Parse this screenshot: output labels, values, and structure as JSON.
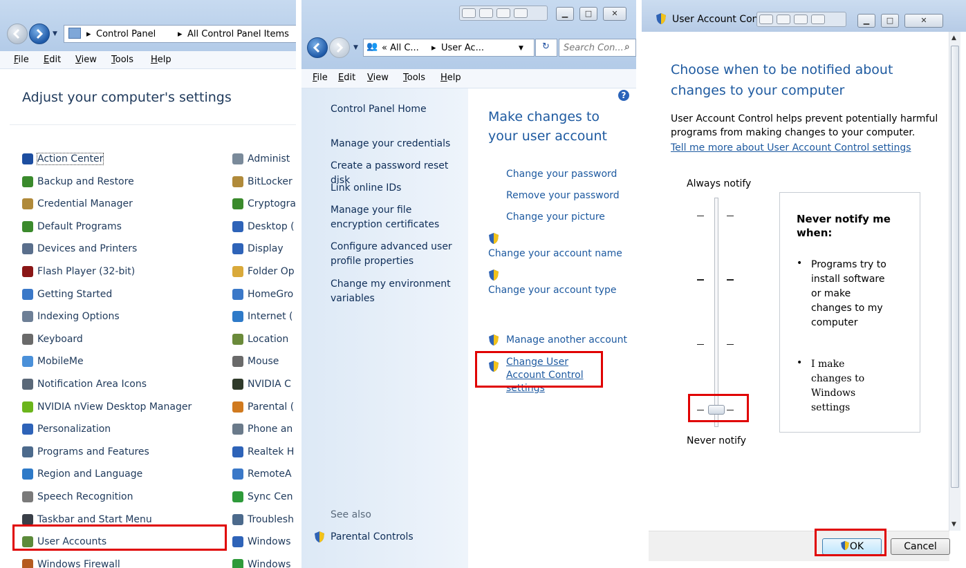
{
  "panel1": {
    "breadcrumb": [
      "Control Panel",
      "All Control Panel Items"
    ],
    "menu": [
      "File",
      "Edit",
      "View",
      "Tools",
      "Help"
    ],
    "heading": "Adjust your computer's settings",
    "left_items": [
      {
        "label": "Action Center",
        "icon": "flag-icon",
        "color": "#1d4ea0"
      },
      {
        "label": "Backup and Restore",
        "icon": "backup-icon",
        "color": "#3a8a2c"
      },
      {
        "label": "Credential Manager",
        "icon": "vault-icon",
        "color": "#b08a3a"
      },
      {
        "label": "Default Programs",
        "icon": "default-programs-icon",
        "color": "#3b8a2c"
      },
      {
        "label": "Devices and Printers",
        "icon": "printer-icon",
        "color": "#5a6f8c"
      },
      {
        "label": "Flash Player (32-bit)",
        "icon": "flash-icon",
        "color": "#8a1616"
      },
      {
        "label": "Getting Started",
        "icon": "getting-started-icon",
        "color": "#3a78c8"
      },
      {
        "label": "Indexing Options",
        "icon": "indexing-icon",
        "color": "#6d7f96"
      },
      {
        "label": "Keyboard",
        "icon": "keyboard-icon",
        "color": "#6a6a6a"
      },
      {
        "label": "MobileMe",
        "icon": "cloud-icon",
        "color": "#4a90d9"
      },
      {
        "label": "Notification Area Icons",
        "icon": "notification-icon",
        "color": "#5a6878"
      },
      {
        "label": "NVIDIA nView Desktop Manager",
        "icon": "nvidia-icon",
        "color": "#6bb51c"
      },
      {
        "label": "Personalization",
        "icon": "personalization-icon",
        "color": "#2e63b8"
      },
      {
        "label": "Programs and Features",
        "icon": "programs-icon",
        "color": "#4c6a8c"
      },
      {
        "label": "Region and Language",
        "icon": "globe-icon",
        "color": "#2e7ac8"
      },
      {
        "label": "Speech Recognition",
        "icon": "microphone-icon",
        "color": "#7a7a7a"
      },
      {
        "label": "Taskbar and Start Menu",
        "icon": "taskbar-icon",
        "color": "#3a3f48"
      },
      {
        "label": "User Accounts",
        "icon": "users-icon",
        "color": "#5c8a3a"
      },
      {
        "label": "Windows Firewall",
        "icon": "firewall-icon",
        "color": "#b55a1f"
      }
    ],
    "right_items": [
      {
        "label": "Administ",
        "icon": "admin-tools-icon",
        "color": "#7a8a9a"
      },
      {
        "label": "BitLocker",
        "icon": "bitlocker-icon",
        "color": "#b08a3a"
      },
      {
        "label": "Cryptogra",
        "icon": "crypto-icon",
        "color": "#3a8a2c"
      },
      {
        "label": "Desktop (",
        "icon": "desktop-gadgets-icon",
        "color": "#2e63b8"
      },
      {
        "label": "Display",
        "icon": "display-icon",
        "color": "#2e63b8"
      },
      {
        "label": "Folder Op",
        "icon": "folder-icon",
        "color": "#d9a93a"
      },
      {
        "label": "HomeGro",
        "icon": "homegroup-icon",
        "color": "#3a78c8"
      },
      {
        "label": "Internet (",
        "icon": "internet-icon",
        "color": "#2e7ac8"
      },
      {
        "label": "Location",
        "icon": "location-icon",
        "color": "#6a8a3a"
      },
      {
        "label": "Mouse",
        "icon": "mouse-icon",
        "color": "#6a6a6a"
      },
      {
        "label": "NVIDIA C",
        "icon": "nvidia-icon",
        "color": "#2f3a2a"
      },
      {
        "label": "Parental (",
        "icon": "parental-icon",
        "color": "#d07a1f"
      },
      {
        "label": "Phone an",
        "icon": "phone-icon",
        "color": "#6a7a8a"
      },
      {
        "label": "Realtek H",
        "icon": "realtek-icon",
        "color": "#2e63b8"
      },
      {
        "label": "RemoteA",
        "icon": "remoteapp-icon",
        "color": "#3a78c8"
      },
      {
        "label": "Sync Cen",
        "icon": "sync-icon",
        "color": "#2e9a3a"
      },
      {
        "label": "Troublesh",
        "icon": "troubleshoot-icon",
        "color": "#4c6a8c"
      },
      {
        "label": "Windows",
        "icon": "windows-cardspace-icon",
        "color": "#2e63b8"
      },
      {
        "label": "Windows",
        "icon": "windows-defender-icon",
        "color": "#2e9a3a"
      }
    ]
  },
  "panel2": {
    "address": [
      "« All C...",
      "User Ac..."
    ],
    "search_placeholder": "Search Con...",
    "menu": [
      "File",
      "Edit",
      "View",
      "Tools",
      "Help"
    ],
    "tasks": [
      "Control Panel Home",
      "Manage your credentials",
      "Create a password reset disk",
      "Link online IDs",
      "Manage your file encryption certificates",
      "Configure advanced user profile properties",
      "Change my environment variables"
    ],
    "see_also": "See also",
    "parental": "Parental Controls",
    "heading": "Make changes to your user account",
    "links": {
      "change_password": "Change your password",
      "remove_password": "Remove your password",
      "change_picture": "Change your picture",
      "change_name": "Change your account name",
      "change_type": "Change your account type",
      "manage_other": "Manage another account",
      "uac": "Change User Account Control settings"
    }
  },
  "panel3": {
    "title": "User Account Contr",
    "heading": "Choose when to be notified about changes to your computer",
    "description": "User Account Control helps prevent potentially harmful programs from making changes to your computer.",
    "more_link": "Tell me more about User Account Control settings",
    "always_label": "Always notify",
    "never_label": "Never notify",
    "slider_level": 0,
    "slider_levels": 4,
    "box_heading": "Never notify me when:",
    "bullets": [
      "Programs try to install software or make changes to my computer",
      "I make changes to Windows settings"
    ],
    "ok": "OK",
    "cancel": "Cancel"
  },
  "colors": {
    "highlight": "#e00000",
    "link": "#1e5aa0",
    "heading": "#1e395b"
  }
}
